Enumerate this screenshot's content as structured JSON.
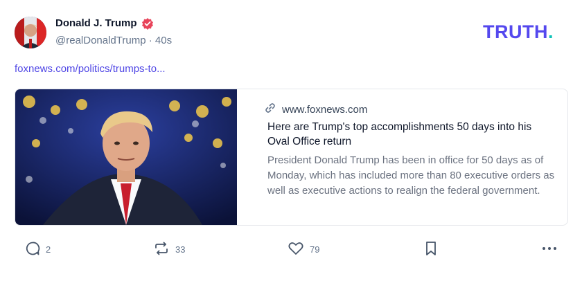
{
  "post": {
    "author_name": "Donald J. Trump",
    "handle": "@realDonaldTrump",
    "time_ago": "40s",
    "link_text": "foxnews.com/politics/trumps-to..."
  },
  "brand": {
    "logo_text": "TRUTH",
    "logo_dot": "."
  },
  "card": {
    "domain": "www.foxnews.com",
    "title": "Here are Trump's top accomplishments 50 days into his Oval Office return",
    "description": "President Donald Trump has been in office for 50 days as of Monday, which has included more than 80 executive orders as well as executive actions to realign the federal government."
  },
  "actions": {
    "replies": "2",
    "retruths": "33",
    "likes": "79"
  },
  "colors": {
    "brand": "#5448ee",
    "accent_dot": "#0ec2b8",
    "verified": "#e8445a",
    "link": "#4f46e5"
  },
  "icons": [
    "verified-badge-icon",
    "link-icon",
    "reply-icon",
    "retruth-icon",
    "heart-icon",
    "bookmark-icon",
    "more-icon"
  ]
}
